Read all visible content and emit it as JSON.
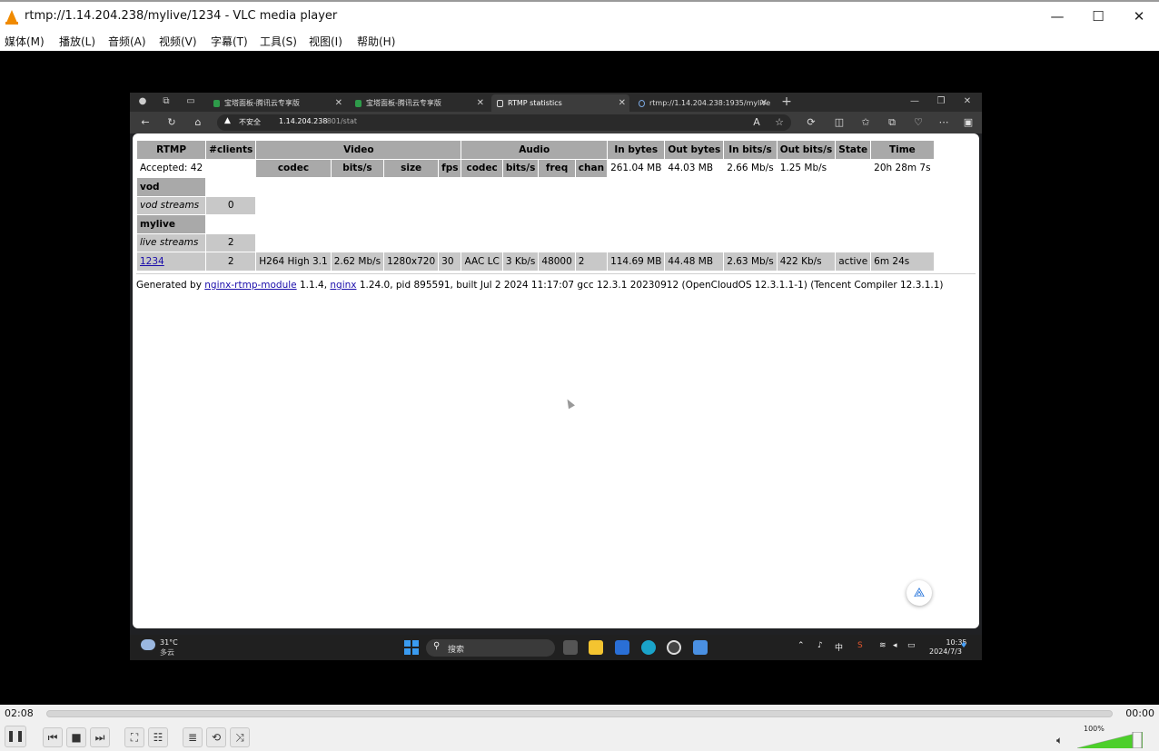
{
  "window": {
    "title": "rtmp://1.14.204.238/mylive/1234 - VLC media player",
    "minimize": "—",
    "maximize": "☐",
    "close": "✕"
  },
  "menu": [
    "媒体(M)",
    "播放(L)",
    "音频(A)",
    "视频(V)",
    "字幕(T)",
    "工具(S)",
    "视图(I)",
    "帮助(H)"
  ],
  "browser": {
    "tabs": [
      {
        "label": "宝塔面板-腾讯云专享版",
        "active": false
      },
      {
        "label": "宝塔面板-腾讯云专享版",
        "active": false
      },
      {
        "label": "RTMP statistics",
        "active": true
      },
      {
        "label": "rtmp://1.14.204.238:1935/mylive",
        "active": false
      }
    ],
    "new_tab": "+",
    "address": {
      "insecure_label": "不安全",
      "host": "1.14.204.238",
      "path": ":801/stat"
    }
  },
  "stats": {
    "headers": {
      "rtmp": "RTMP",
      "clients": "#clients",
      "video": "Video",
      "audio": "Audio",
      "in_bytes": "In bytes",
      "out_bytes": "Out bytes",
      "in_bits": "In bits/s",
      "out_bits": "Out bits/s",
      "state": "State",
      "time": "Time"
    },
    "subheaders": {
      "v_codec": "codec",
      "v_bits": "bits/s",
      "v_size": "size",
      "v_fps": "fps",
      "a_codec": "codec",
      "a_bits": "bits/s",
      "a_freq": "freq",
      "a_chan": "chan"
    },
    "server": {
      "accepted": "Accepted: 42",
      "in_bytes": "261.04 MB",
      "out_bytes": "44.03 MB",
      "in_bits": "2.66 Mb/s",
      "out_bits": "1.25 Mb/s",
      "time": "20h 28m 7s"
    },
    "vod": {
      "name": "vod",
      "streams_label": "vod streams",
      "streams": "0"
    },
    "mylive": {
      "name": "mylive",
      "streams_label": "live streams",
      "streams": "2"
    },
    "stream": {
      "name": "1234",
      "clients": "2",
      "v_codec": "H264 High 3.1",
      "v_bits": "2.62 Mb/s",
      "v_size": "1280x720",
      "v_fps": "30",
      "a_codec": "AAC LC",
      "a_bits": "3 Kb/s",
      "a_freq": "48000",
      "a_chan": "2",
      "in_bytes": "114.69 MB",
      "out_bytes": "44.48 MB",
      "in_bits": "2.63 Mb/s",
      "out_bits": "422 Kb/s",
      "state": "active",
      "time": "6m 24s"
    },
    "footer": {
      "prefix": "Generated by ",
      "module_link": "nginx-rtmp-module",
      "module_ver": " 1.1.4, ",
      "nginx_link": "nginx",
      "rest": " 1.24.0, pid 895591, built Jul 2 2024 11:17:07 gcc 12.3.1 20230912 (OpenCloudOS 12.3.1.1-1) (Tencent Compiler 12.3.1.1)"
    }
  },
  "taskbar": {
    "weather_temp": "31°C",
    "weather_desc": "多云",
    "search_placeholder": "搜索",
    "ime": "中",
    "clock_time": "10:35",
    "clock_date": "2024/7/3"
  },
  "vlc": {
    "elapsed": "02:08",
    "total": "00:00",
    "volume": "100%",
    "volume_level": 1.0
  },
  "colors": {
    "vlc_orange": "#f08a00",
    "stats_header": "#a9a9a9",
    "stats_cell": "#c8c8c8",
    "link": "#1a0dab"
  }
}
